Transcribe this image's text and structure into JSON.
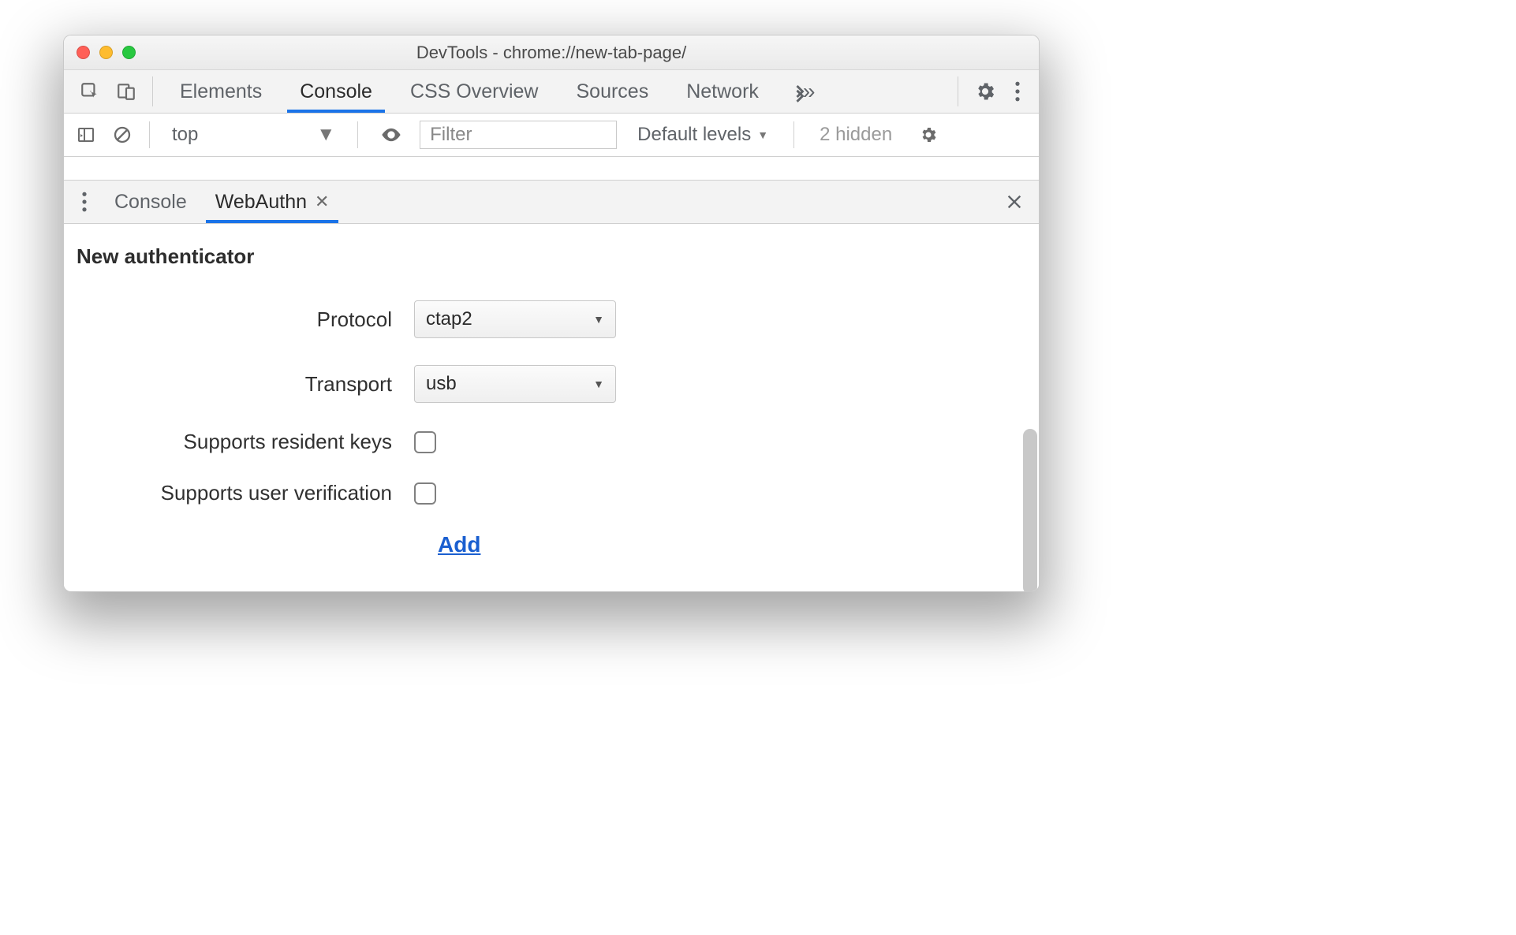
{
  "window": {
    "title": "DevTools - chrome://new-tab-page/"
  },
  "top_tabs": {
    "items": [
      "Elements",
      "Console",
      "CSS Overview",
      "Sources",
      "Network"
    ],
    "active_index": 1
  },
  "console_toolbar": {
    "context": "top",
    "filter_placeholder": "Filter",
    "levels_label": "Default levels",
    "hidden_text": "2 hidden"
  },
  "drawer": {
    "tabs": [
      {
        "label": "Console",
        "closable": false
      },
      {
        "label": "WebAuthn",
        "closable": true
      }
    ],
    "active_index": 1
  },
  "webauthn": {
    "section_title": "New authenticator",
    "rows": {
      "protocol_label": "Protocol",
      "protocol_value": "ctap2",
      "transport_label": "Transport",
      "transport_value": "usb",
      "resident_label": "Supports resident keys",
      "userverif_label": "Supports user verification"
    },
    "add_label": "Add"
  }
}
